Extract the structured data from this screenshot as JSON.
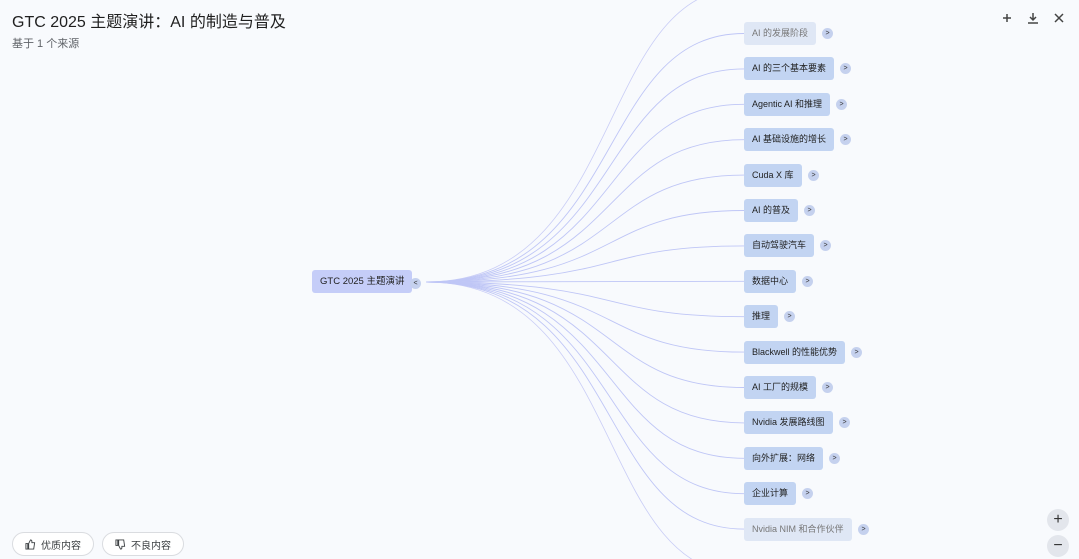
{
  "header": {
    "title": "GTC 2025 主题演讲：AI 的制造与普及",
    "subtitle": "基于 1 个来源"
  },
  "toolbar": {
    "collapse_icon": "collapse-icon",
    "download_icon": "download-icon",
    "close_icon": "close-icon"
  },
  "mindmap": {
    "root": {
      "label": "GTC 2025 主题演讲",
      "expander": "<"
    },
    "children": [
      {
        "label": "AI 的发展阶段",
        "faded": true
      },
      {
        "label": "AI 的三个基本要素"
      },
      {
        "label": "Agentic AI 和推理"
      },
      {
        "label": "AI 基础设施的增长"
      },
      {
        "label": "Cuda X 库"
      },
      {
        "label": "AI 的普及"
      },
      {
        "label": "自动驾驶汽车"
      },
      {
        "label": "数据中心"
      },
      {
        "label": "推理"
      },
      {
        "label": "Blackwell 的性能优势"
      },
      {
        "label": "AI 工厂的规模"
      },
      {
        "label": "Nvidia 发展路线图"
      },
      {
        "label": "向外扩展：网络"
      },
      {
        "label": "企业计算"
      },
      {
        "label": "Nvidia NIM 和合作伙伴",
        "faded": true
      }
    ],
    "child_expander": ">"
  },
  "feedback": {
    "good_label": "优质内容",
    "bad_label": "不良内容"
  },
  "zoom": {
    "in_label": "+",
    "out_label": "−"
  }
}
